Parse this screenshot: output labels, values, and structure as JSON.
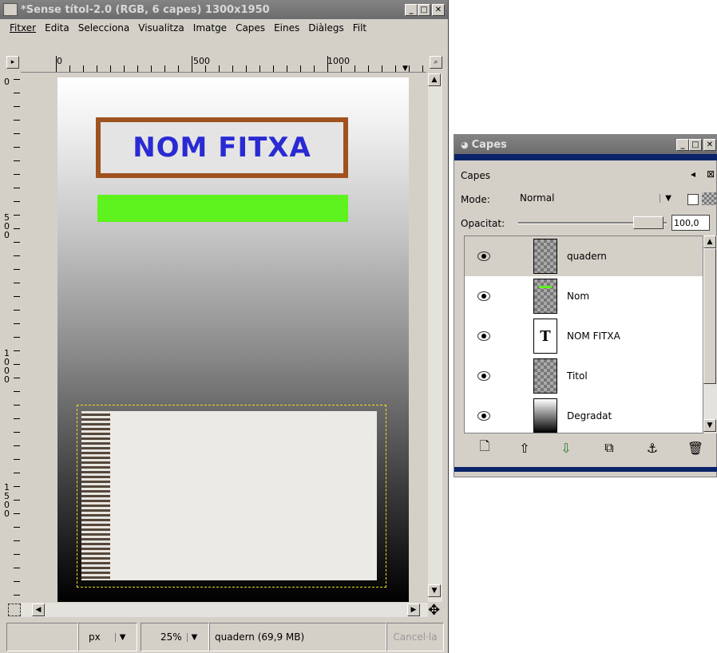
{
  "main_window": {
    "title": "*Sense títol-2.0 (RGB, 6 capes) 1300x1950",
    "menu": [
      "Fitxer",
      "Edita",
      "Selecciona",
      "Visualitza",
      "Imatge",
      "Capes",
      "Eines",
      "Diàlegs",
      "Filt"
    ],
    "ruler_h_labels": [
      "0",
      "500",
      "1000"
    ],
    "ruler_v_labels": [
      "0",
      "5\n0\n0",
      "1\n0\n0\n0",
      "1\n5\n0\n0"
    ],
    "canvas": {
      "title_text": "NOM FITXA",
      "title_color": "#2a2ad4",
      "frame_color": "#a0521e",
      "bar_color": "#5ef21e"
    },
    "status": {
      "unit": "px",
      "zoom": "25%",
      "info": "quadern (69,9 MB)",
      "cancel": "Cancel·la"
    }
  },
  "layers_dialog": {
    "title": "Capes",
    "section_label": "Capes",
    "mode_label": "Mode:",
    "mode_value": "Normal",
    "opacity_label": "Opacitat:",
    "opacity_value": "100,0",
    "opacity_fraction": 1.0,
    "layers": [
      {
        "name": "quadern",
        "thumb": "notebook",
        "selected": true
      },
      {
        "name": "Nom",
        "thumb": "green-bar",
        "selected": false
      },
      {
        "name": "NOM FITXA",
        "thumb": "text",
        "selected": false
      },
      {
        "name": "Titol",
        "thumb": "checker",
        "selected": false
      },
      {
        "name": "Degradat",
        "thumb": "gradient",
        "selected": false
      }
    ],
    "buttons": [
      "new-layer-icon",
      "raise-layer-icon",
      "lower-layer-icon",
      "duplicate-layer-icon",
      "anchor-layer-icon",
      "delete-layer-icon"
    ]
  }
}
